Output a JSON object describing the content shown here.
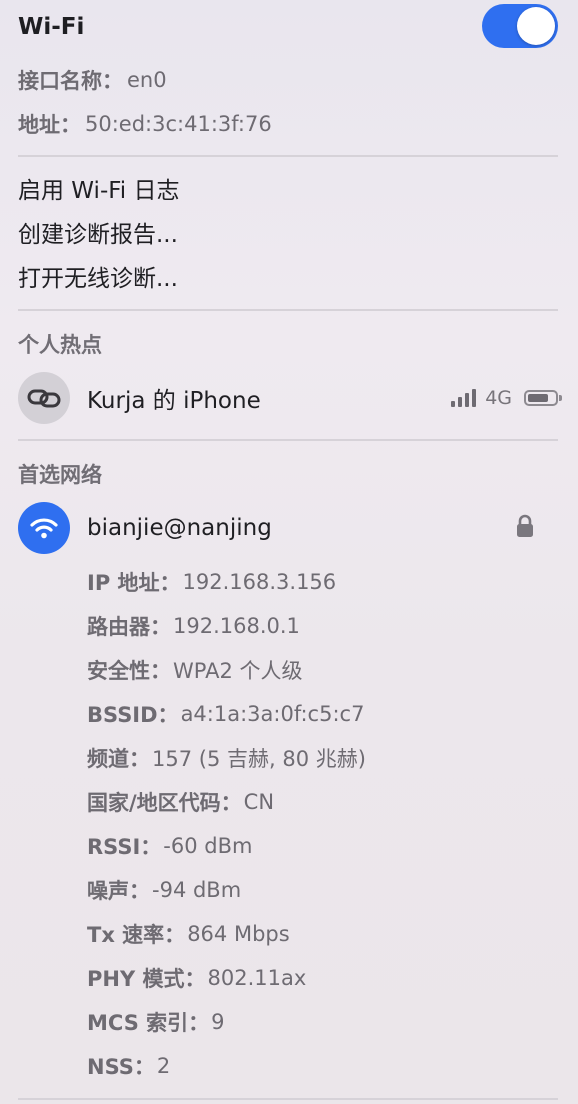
{
  "header": {
    "title": "Wi-Fi",
    "toggle_on": true
  },
  "interface": {
    "name_label": "接口名称：",
    "name_value": "en0",
    "address_label": "地址：",
    "address_value": "50:ed:3c:41:3f:76"
  },
  "actions": {
    "enable_log": "启用 Wi-Fi 日志",
    "create_report": "创建诊断报告...",
    "open_diagnostics": "打开无线诊断..."
  },
  "hotspot": {
    "section_title": "个人热点",
    "device_name": "Kurja 的 iPhone",
    "cellular": "4G",
    "signal_bars": 4,
    "battery_level": 0.75,
    "icon": "link-icon"
  },
  "preferred": {
    "section_title": "首选网络",
    "network_name": "bianjie@nanjing",
    "icon": "wifi-icon",
    "secured": true,
    "details": [
      {
        "label": "IP 地址：",
        "value": "192.168.3.156"
      },
      {
        "label": "路由器：",
        "value": "192.168.0.1"
      },
      {
        "label": "安全性：",
        "value": "WPA2 个人级"
      },
      {
        "label": "BSSID：",
        "value": "a4:1a:3a:0f:c5:c7"
      },
      {
        "label": "频道：",
        "value": "157 (5 吉赫, 80 兆赫)"
      },
      {
        "label": "国家/地区代码：",
        "value": "CN"
      },
      {
        "label": "RSSI：",
        "value": "-60 dBm"
      },
      {
        "label": "噪声：",
        "value": "-94 dBm"
      },
      {
        "label": "Tx 速率：",
        "value": "864 Mbps"
      },
      {
        "label": "PHY 模式：",
        "value": "802.11ax"
      },
      {
        "label": "MCS 索引：",
        "value": "9"
      },
      {
        "label": "NSS：",
        "value": "2"
      }
    ]
  },
  "colors": {
    "accent": "#2f6ff0",
    "secondary_text": "#6e6b72",
    "divider": "#d6d2d8"
  }
}
